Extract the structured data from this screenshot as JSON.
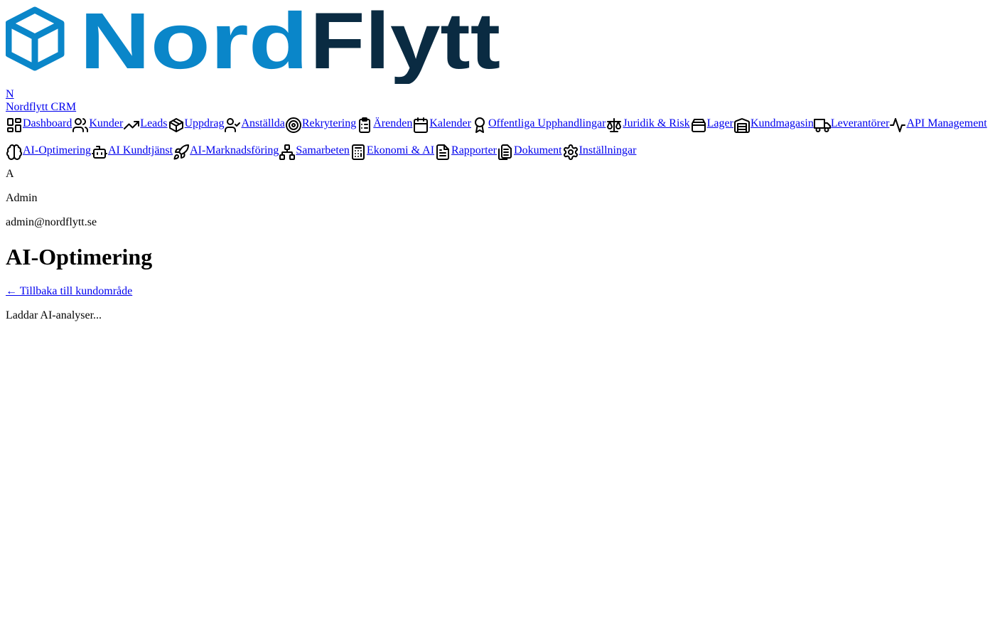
{
  "brand": {
    "logo_part1": "Nord",
    "logo_part2": "Flytt",
    "colors": {
      "primary": "#0a86c9",
      "dark": "#0a2b42"
    },
    "initial": "N",
    "name": "Nordflytt CRM"
  },
  "nav": {
    "row1": [
      {
        "label": "Dashboard",
        "icon": "dashboard-icon"
      },
      {
        "label": "Kunder",
        "icon": "users-icon"
      },
      {
        "label": "Leads",
        "icon": "trending-up-icon"
      },
      {
        "label": "Uppdrag",
        "icon": "package-icon"
      },
      {
        "label": "Anställda",
        "icon": "user-check-icon"
      },
      {
        "label": "Rekrytering",
        "icon": "target-icon"
      },
      {
        "label": "Ärenden",
        "icon": "clipboard-list-icon"
      },
      {
        "label": "Kalender",
        "icon": "calendar-icon"
      },
      {
        "label": "Offentliga Upphandlingar",
        "icon": "award-icon"
      },
      {
        "label": "Juridik & Risk",
        "icon": "scale-icon"
      },
      {
        "label": "Lager",
        "icon": "box-icon"
      },
      {
        "label": "Kundmagasin",
        "icon": "warehouse-icon"
      },
      {
        "label": "Leverantörer",
        "icon": "truck-icon"
      },
      {
        "label": "API Management",
        "icon": "activity-icon"
      }
    ],
    "row2": [
      {
        "label": "AI-Optimering",
        "icon": "brain-icon"
      },
      {
        "label": "AI Kundtjänst",
        "icon": "bot-icon"
      },
      {
        "label": "AI-Marknadsföring",
        "icon": "rocket-icon"
      },
      {
        "label": "Samarbeten",
        "icon": "network-icon"
      },
      {
        "label": "Ekonomi & AI",
        "icon": "calculator-icon"
      },
      {
        "label": "Rapporter",
        "icon": "file-text-icon"
      },
      {
        "label": "Dokument",
        "icon": "files-icon"
      },
      {
        "label": "Inställningar",
        "icon": "settings-icon"
      }
    ]
  },
  "user": {
    "avatar_initial": "A",
    "name": "Admin",
    "email": "admin@nordflytt.se"
  },
  "main": {
    "title": "AI-Optimering",
    "back_link": "← Tillbaka till kundområde",
    "loading_text": "Laddar AI-analyser..."
  }
}
